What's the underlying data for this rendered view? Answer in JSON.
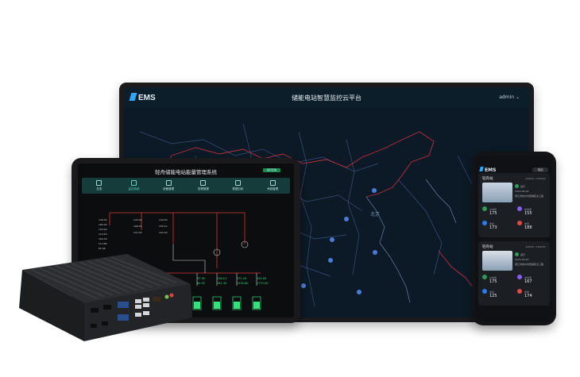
{
  "monitor": {
    "logo": "EMS",
    "title": "储能电站智慧监控云平台",
    "user": "admin",
    "map_label": "北京"
  },
  "tablet": {
    "title": "轻舟储能电站能量管理系统",
    "badge": "运行正常",
    "nav": [
      {
        "label": "总览",
        "icon": "grid-icon"
      },
      {
        "label": "监控系统",
        "icon": "network-icon"
      },
      {
        "label": "设备管理",
        "icon": "frame-icon"
      },
      {
        "label": "告警管理",
        "icon": "warning-icon"
      },
      {
        "label": "数据分析",
        "icon": "chart-icon"
      },
      {
        "label": "系统管理",
        "icon": "gear-icon"
      }
    ],
    "active_nav": 1,
    "readouts": [
      "149.05",
      "182.00",
      "150.00",
      "110.50",
      "162.00",
      "113.86",
      "61.66",
      "143.00",
      "168.35",
      "147.00",
      "144.30",
      "155.15",
      "152.50",
      "97.50",
      "138.11",
      "371.20",
      "192.00",
      "60.32",
      "761.30",
      "1155.60",
      "1772.50"
    ]
  },
  "phone": {
    "logo": "EMS",
    "badge": "电站",
    "sites": [
      {
        "name": "轻舟站",
        "capacity": "100kW / 150kWh",
        "status": "运行",
        "date": "2023-05-20",
        "address": "浙江省杭州市西湖区文三路",
        "metrics": [
          {
            "label": "充电量",
            "value": "175"
          },
          {
            "label": "放电量",
            "value": "155"
          },
          {
            "label": "收益",
            "value": "173"
          },
          {
            "label": "效率",
            "value": "188"
          }
        ]
      },
      {
        "name": "轻舟站",
        "capacity": "100kW / 150kWh",
        "status": "运行",
        "date": "2023-05-20",
        "address": "浙江省杭州市西湖区文三路",
        "metrics": [
          {
            "label": "充电量",
            "value": "175"
          },
          {
            "label": "放电量",
            "value": "167"
          },
          {
            "label": "收益",
            "value": "125"
          },
          {
            "label": "效率",
            "value": "174"
          }
        ]
      }
    ]
  },
  "colors": {
    "accent": "#2ea7ff",
    "green": "#36e07a",
    "red": "#d33a3a",
    "nav_bg": "#153c3b"
  }
}
